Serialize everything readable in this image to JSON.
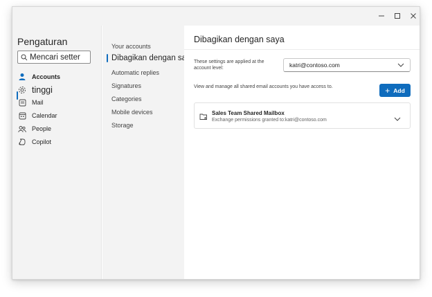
{
  "window": {
    "controls": {
      "minimize": "−",
      "maximize": "☐",
      "close": "✕"
    }
  },
  "sidebar": {
    "title": "Pengaturan",
    "search_placeholder": "Mencari setter",
    "items": [
      {
        "label": "Accounts",
        "icon": "person-icon",
        "active": true
      },
      {
        "label": "tinggi",
        "icon": "gear-icon",
        "active": false
      },
      {
        "label": "Mail",
        "icon": "mail-icon",
        "active": false
      },
      {
        "label": "Calendar",
        "icon": "calendar-icon",
        "active": false
      },
      {
        "label": "People",
        "icon": "people-icon",
        "active": false
      },
      {
        "label": "Copilot",
        "icon": "copilot-icon",
        "active": false
      }
    ]
  },
  "subnav": {
    "items": [
      {
        "label": "Your accounts",
        "active": false
      },
      {
        "label": "Dibagikan dengan saya",
        "active": true
      },
      {
        "label": "Automatic replies",
        "active": false
      },
      {
        "label": "Signatures",
        "active": false
      },
      {
        "label": "Categories",
        "active": false
      },
      {
        "label": "Mobile devices",
        "active": false
      },
      {
        "label": "Storage",
        "active": false
      }
    ]
  },
  "main": {
    "title": "Dibagikan dengan saya",
    "applied_text": "These settings are applied at the account level:",
    "account_select": "katri@contoso.com",
    "view_text": "View and manage all shared email accounts you have access to.",
    "add_label": "Add",
    "mailbox": {
      "name": "Sales Team Shared Mailbox",
      "subtitle": "Exchange permissions granted to:katri@contoso.com"
    }
  },
  "colors": {
    "accent": "#0f6cbd",
    "sidebar_bg": "#f3f3f3"
  }
}
